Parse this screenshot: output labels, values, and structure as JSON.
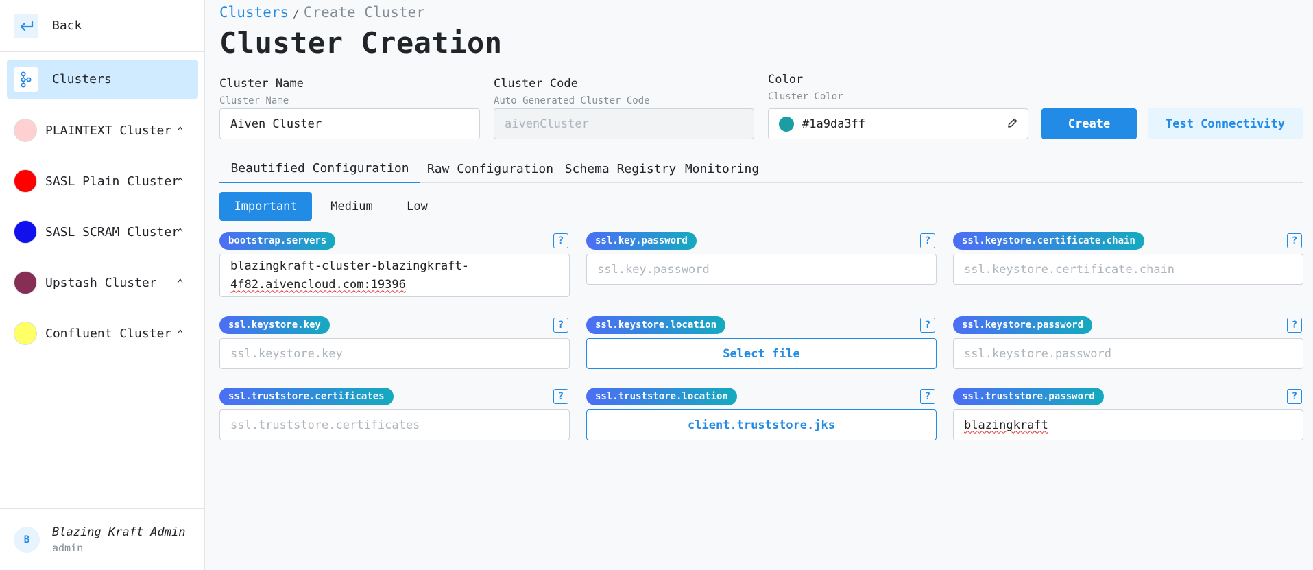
{
  "sidebar": {
    "back_label": "Back",
    "clusters_label": "Clusters",
    "clusters": [
      {
        "label": "PLAINTEXT Cluster",
        "color": "#ffd0d0"
      },
      {
        "label": "SASL Plain Cluster",
        "color": "#ff0000"
      },
      {
        "label": "SASL SCRAM Cluster",
        "color": "#1111ee"
      },
      {
        "label": "Upstash Cluster",
        "color": "#862e55"
      },
      {
        "label": "Confluent Cluster",
        "color": "#ffff66"
      }
    ],
    "user": {
      "initial": "B",
      "name": "Blazing Kraft Admin",
      "role": "admin"
    }
  },
  "breadcrumb": {
    "link": "Clusters",
    "separator": "/",
    "current": "Create Cluster"
  },
  "page_title": "Cluster Creation",
  "form": {
    "name": {
      "label": "Cluster Name",
      "desc": "Cluster Name",
      "value": "Aiven Cluster"
    },
    "code": {
      "label": "Cluster Code",
      "desc": "Auto Generated Cluster Code",
      "placeholder": "aivenCluster"
    },
    "color": {
      "label": "Color",
      "desc": "Cluster Color",
      "value": "#1a9da3ff",
      "swatch": "#1a9da3"
    },
    "create_label": "Create",
    "test_label": "Test Connectivity"
  },
  "tabs": [
    "Beautified Configuration",
    "Raw Configuration",
    "Schema Registry",
    "Monitoring"
  ],
  "priority": [
    "Important",
    "Medium",
    "Low"
  ],
  "help_glyph": "?",
  "config": {
    "bootstrap_servers": {
      "key": "bootstrap.servers",
      "value_line1": "blazingkraft-cluster-blazingkraft-",
      "value_line2": "4f82.aivencloud.com:19396"
    },
    "ssl_key_password": {
      "key": "ssl.key.password",
      "placeholder": "ssl.key.password"
    },
    "ssl_keystore_certificate_chain": {
      "key": "ssl.keystore.certificate.chain",
      "placeholder": "ssl.keystore.certificate.chain"
    },
    "ssl_keystore_key": {
      "key": "ssl.keystore.key",
      "placeholder": "ssl.keystore.key"
    },
    "ssl_keystore_location": {
      "key": "ssl.keystore.location",
      "button": "Select file"
    },
    "ssl_keystore_password": {
      "key": "ssl.keystore.password",
      "placeholder": "ssl.keystore.password"
    },
    "ssl_truststore_certificates": {
      "key": "ssl.truststore.certificates",
      "placeholder": "ssl.truststore.certificates"
    },
    "ssl_truststore_location": {
      "key": "ssl.truststore.location",
      "button": "client.truststore.jks"
    },
    "ssl_truststore_password": {
      "key": "ssl.truststore.password",
      "value": "blazingkraft"
    }
  },
  "colors": {
    "accent": "#228be6",
    "active_nav": "#d0ebff"
  }
}
